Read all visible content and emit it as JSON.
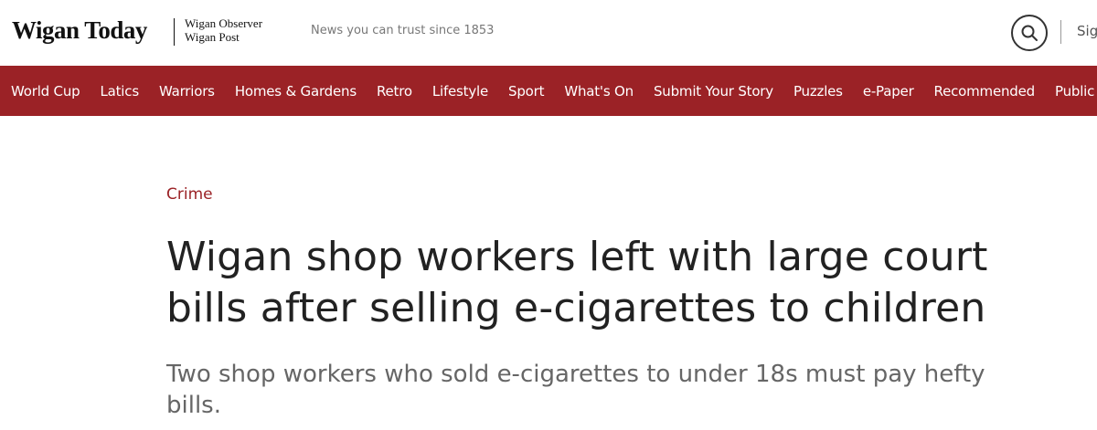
{
  "header": {
    "logo_main": "Wigan Today",
    "logo_sub_1": "Wigan Observer",
    "logo_sub_2": "Wigan Post",
    "tagline": "News you can trust since 1853",
    "search_icon": "search-icon",
    "signin_label": "Sign"
  },
  "nav": {
    "items": [
      "World Cup",
      "Latics",
      "Warriors",
      "Homes & Gardens",
      "Retro",
      "Lifestyle",
      "Sport",
      "What's On",
      "Submit Your Story",
      "Puzzles",
      "e-Paper",
      "Recommended",
      "Public"
    ]
  },
  "article": {
    "category": "Crime",
    "headline": "Wigan shop workers left with large court bills after selling e-cigarettes to children",
    "standfirst": "Two shop workers who sold e-cigarettes to under 18s must pay hefty bills."
  },
  "colors": {
    "brand": "#9b2226",
    "text": "#222222",
    "muted": "#666666"
  }
}
